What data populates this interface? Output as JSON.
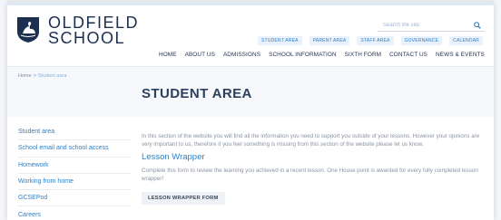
{
  "header": {
    "school_name": "OLDFIELD SCHOOL",
    "search_placeholder": "Search the site",
    "quick_links": [
      "STUDENT AREA",
      "PARENT AREA",
      "STAFF AREA",
      "GOVERNANCE",
      "CALENDAR"
    ],
    "nav": [
      "HOME",
      "ABOUT US",
      "ADMISSIONS",
      "SCHOOL INFORMATION",
      "SIXTH FORM",
      "CONTACT US",
      "NEWS & EVENTS"
    ]
  },
  "breadcrumb": {
    "home": "Home",
    "separator": ">",
    "current": "Student area"
  },
  "page_title": "STUDENT AREA",
  "sidebar": {
    "items": [
      "Student area",
      "School email and school access",
      "Homework",
      "Working from home",
      "GCSEPod",
      "Careers"
    ]
  },
  "content": {
    "intro": "In this section of the website you will find all the information you need to support you outside of your lessons. However your opinions are very important to us, therefore if you feel something is missing from this section of the website please let us know.",
    "section_title": "Lesson Wrapper",
    "section_text": "Complete this form to review the learning you achieved in a recent lesson. One House point is awarded for every fully completed lesson wrapper!",
    "button_label": "LESSON WRAPPER FORM"
  },
  "colors": {
    "brand_navy": "#1d2f4f",
    "link_blue": "#2e80c6",
    "band_background": "#f6f8fb"
  },
  "icons": {
    "logo": "swan-crest-logo",
    "search": "search-icon"
  }
}
